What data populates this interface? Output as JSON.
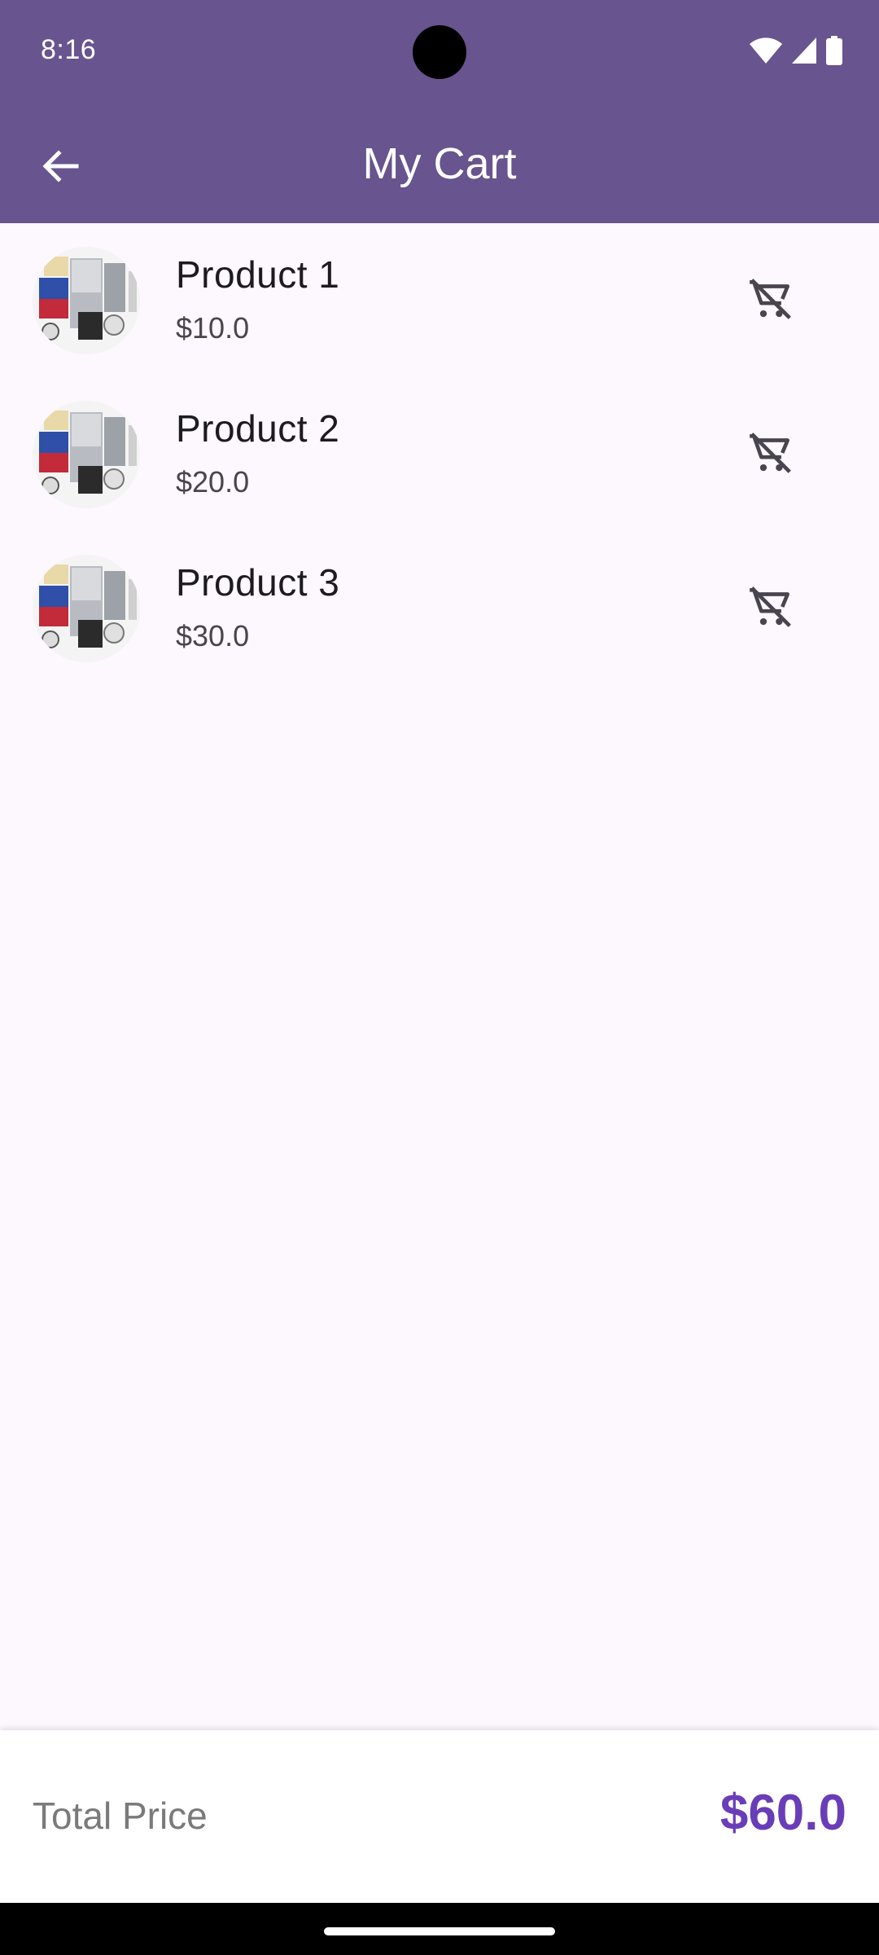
{
  "status_bar": {
    "time": "8:16",
    "icons": [
      "wifi-icon",
      "cellular-signal-icon",
      "battery-icon"
    ]
  },
  "app_bar": {
    "title": "My Cart",
    "back_icon": "arrow-back-icon"
  },
  "cart": {
    "items": [
      {
        "name": "Product 1",
        "price": "$10.0",
        "action_icon": "remove-shopping-cart-icon"
      },
      {
        "name": "Product 2",
        "price": "$20.0",
        "action_icon": "remove-shopping-cart-icon"
      },
      {
        "name": "Product 3",
        "price": "$30.0",
        "action_icon": "remove-shopping-cart-icon"
      }
    ]
  },
  "footer": {
    "total_label": "Total Price",
    "total_value": "$60.0"
  },
  "colors": {
    "app_bar": "#68548e",
    "background": "#fdf7fe",
    "accent": "#6a3db8"
  }
}
